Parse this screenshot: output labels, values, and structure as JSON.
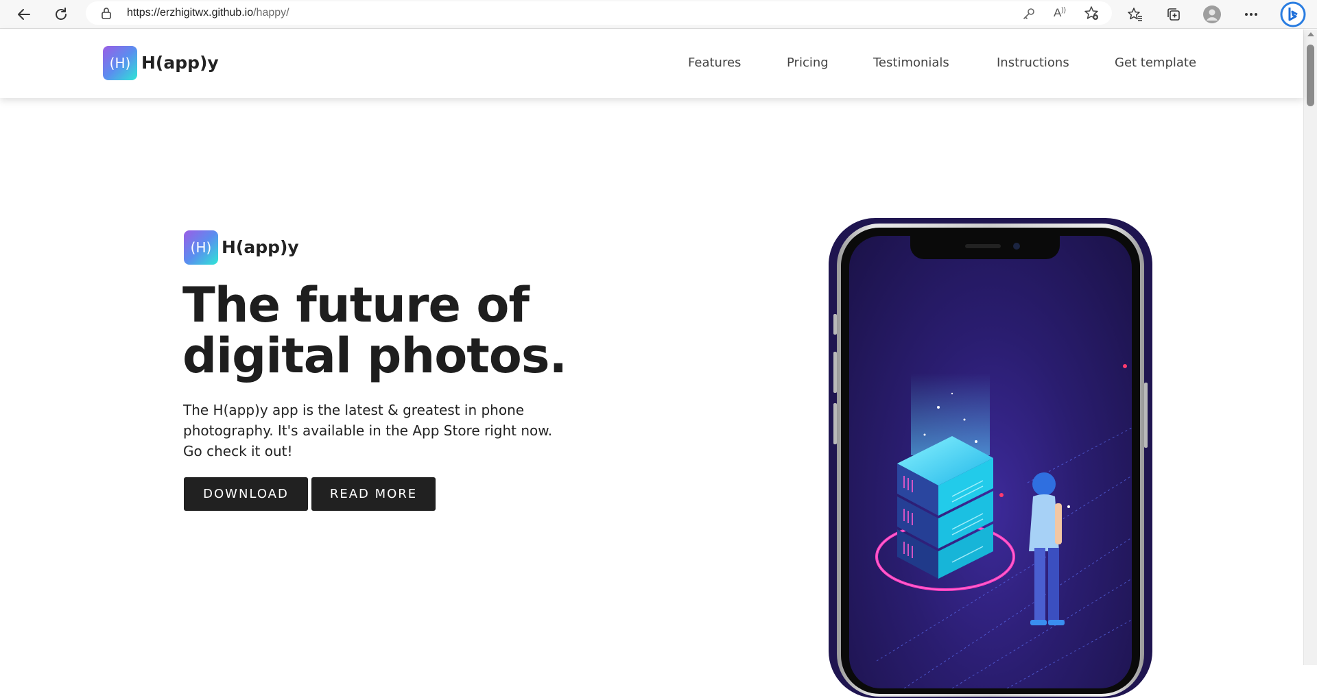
{
  "browser": {
    "url_host": "https://erzhigitwx.github.io",
    "url_path": "/happy/",
    "icons": [
      "back-arrow-icon",
      "refresh-icon",
      "lock-icon",
      "key-icon",
      "read-aloud-icon",
      "add-favorite-icon",
      "favorites-icon",
      "collections-icon",
      "profile-icon",
      "more-icon",
      "bing-icon"
    ]
  },
  "header": {
    "logo_mark": "(H)",
    "logo_text": "H(app)y",
    "nav": [
      {
        "label": "Features"
      },
      {
        "label": "Pricing"
      },
      {
        "label": "Testimonials"
      },
      {
        "label": "Instructions"
      },
      {
        "label": "Get template"
      }
    ]
  },
  "hero": {
    "logo_mark": "(H)",
    "logo_text": "H(app)y",
    "title_line1": "The future of",
    "title_line2": "digital photos.",
    "description": "The H(app)y app is the latest & greatest in phone photography. It's available in the App Store right now. Go check it out!",
    "download_label": "DOWNLOAD",
    "read_more_label": "READ MORE"
  },
  "colors": {
    "button_bg": "#212121",
    "logo_gradient_start": "#9b5de5",
    "logo_gradient_end": "#2ee6d6",
    "phone_screen": "#2a1d70",
    "accent_neon": "#ff3fc1"
  }
}
